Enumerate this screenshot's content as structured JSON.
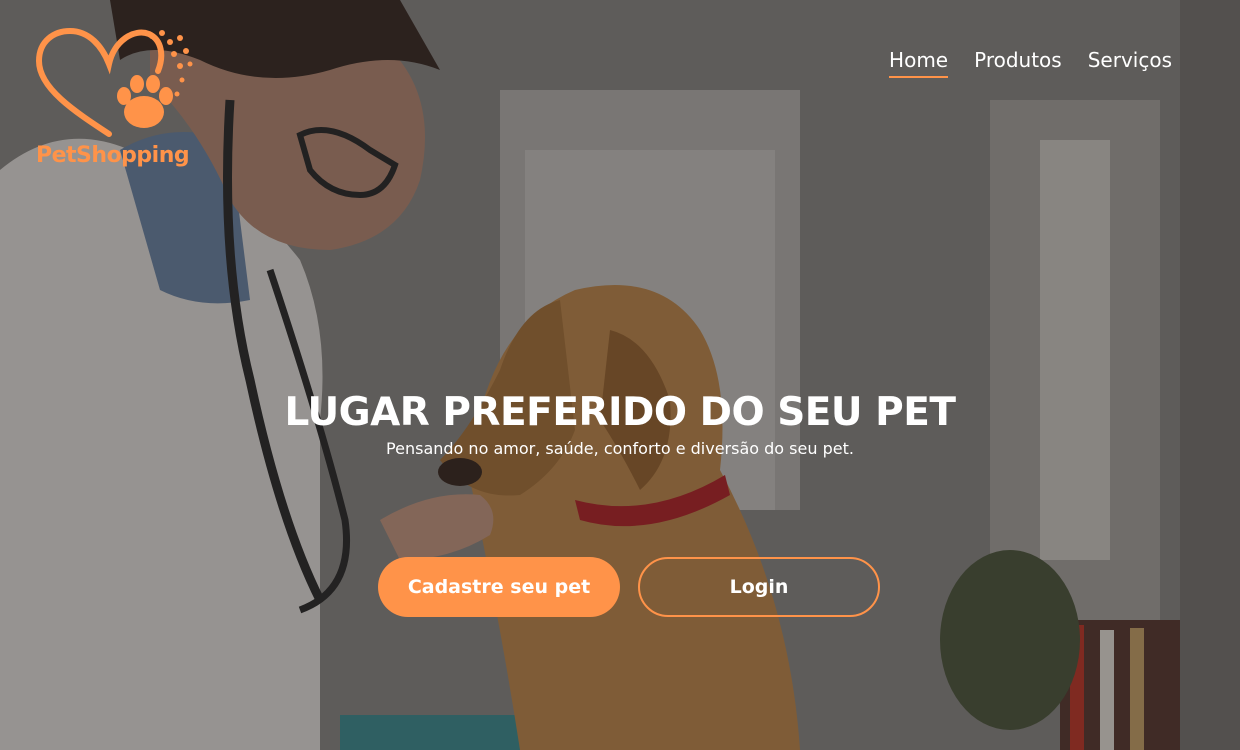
{
  "brand": {
    "name": "PetShopping",
    "logo_icon": "heart-paw-icon"
  },
  "colors": {
    "accent": "#ff9349",
    "text_light": "#ffffff"
  },
  "nav": {
    "items": [
      {
        "label": "Home",
        "active": true
      },
      {
        "label": "Produtos",
        "active": false
      },
      {
        "label": "Serviços",
        "active": false
      }
    ]
  },
  "hero": {
    "title": "LUGAR PREFERIDO DO SEU PET",
    "subtitle": "Pensando no amor, saúde, conforto e diversão do seu pet.",
    "primary_button": "Cadastre seu pet",
    "secondary_button": "Login"
  }
}
